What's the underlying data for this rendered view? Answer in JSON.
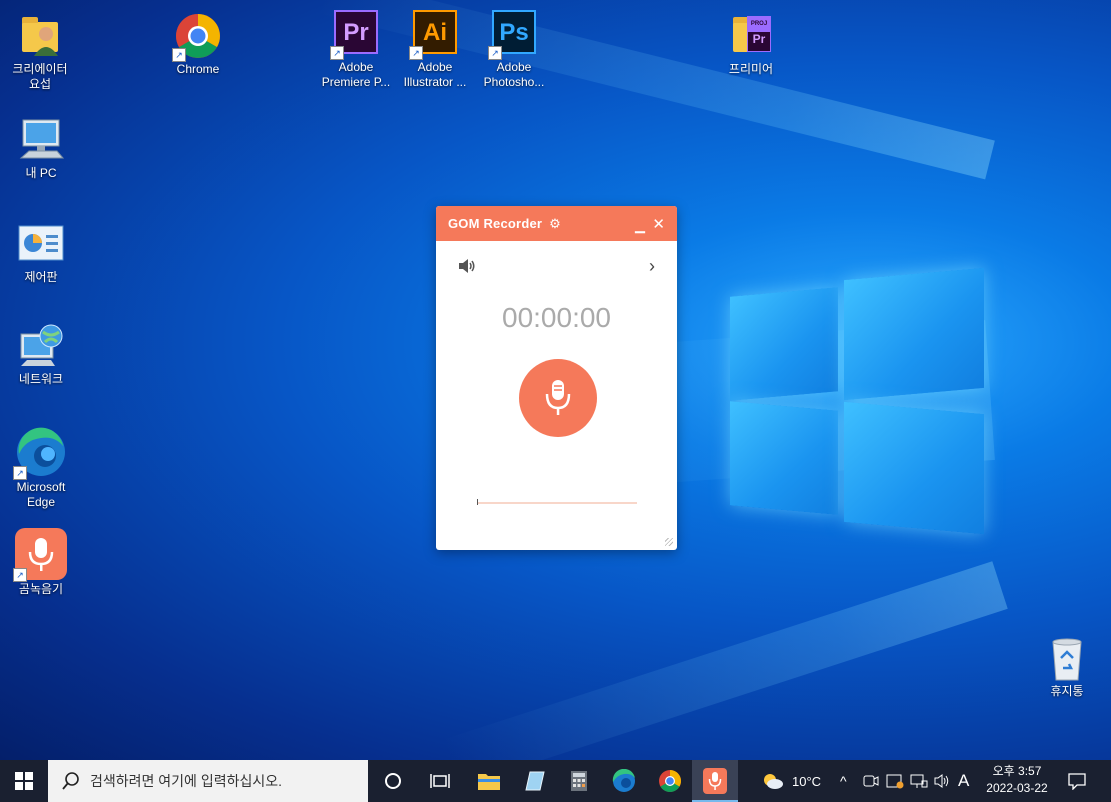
{
  "desktop": {
    "icons": [
      {
        "label_lines": [
          "크리에이터",
          "요섭"
        ]
      },
      {
        "label_lines": [
          "Chrome"
        ]
      },
      {
        "label_lines": [
          "Adobe",
          "Premiere P..."
        ]
      },
      {
        "label_lines": [
          "Adobe",
          "Illustrator ..."
        ]
      },
      {
        "label_lines": [
          "Adobe",
          "Photosho..."
        ]
      },
      {
        "label_lines": [
          "프리미어"
        ]
      },
      {
        "label_lines": [
          "내 PC"
        ]
      },
      {
        "label_lines": [
          "제어판"
        ]
      },
      {
        "label_lines": [
          "네트워크"
        ]
      },
      {
        "label_lines": [
          "Microsoft",
          "Edge"
        ]
      },
      {
        "label_lines": [
          "곰녹음기"
        ]
      },
      {
        "label_lines": [
          "휴지통"
        ]
      }
    ],
    "app_glyphs": {
      "premiere": "Pr",
      "illustrator": "Ai",
      "photoshop": "Ps",
      "premiere_folder_badge": "PROJ"
    }
  },
  "gom": {
    "title": "GOM Recorder",
    "time": "00:00:00",
    "accent": "#f5795a"
  },
  "taskbar": {
    "search_placeholder": "검색하려면 여기에 입력하십시오.",
    "weather": "10°C",
    "ime": "A",
    "time": "오후 3:57",
    "date": "2022-03-22",
    "bg": "#1a2030"
  }
}
